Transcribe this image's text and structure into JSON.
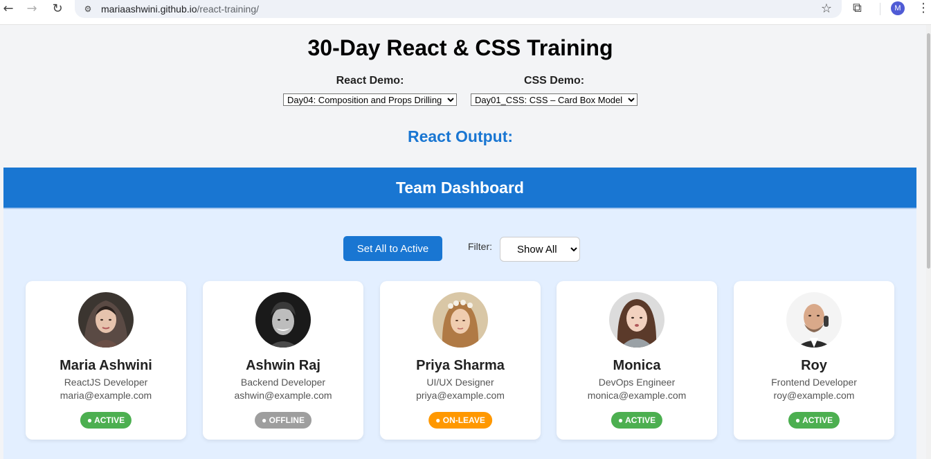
{
  "browser": {
    "url_domain": "mariaashwini.github.io",
    "url_path": "/react-training/",
    "profile_initial": "M",
    "icons": [
      "back-icon",
      "forward-icon",
      "reload-icon",
      "site-info-icon",
      "star-icon",
      "extensions-icon",
      "menu-icon"
    ]
  },
  "page": {
    "title": "30-Day React & CSS Training",
    "react_demo_label": "React Demo:",
    "react_demo_selected": "Day04: Composition and Props Drilling",
    "css_demo_label": "CSS Demo:",
    "css_demo_selected": "Day01_CSS: CSS – Card Box Model",
    "output_heading": "React Output:"
  },
  "dashboard": {
    "title": "Team Dashboard",
    "set_all_button": "Set All to Active",
    "filter_label": "Filter:",
    "filter_selected": "Show All",
    "members": [
      {
        "name": "Maria Ashwini",
        "role": "ReactJS Developer",
        "email": "maria@example.com",
        "status": "● ACTIVE"
      },
      {
        "name": "Ashwin Raj",
        "role": "Backend Developer",
        "email": "ashwin@example.com",
        "status": "● OFFLINE"
      },
      {
        "name": "Priya Sharma",
        "role": "UI/UX Designer",
        "email": "priya@example.com",
        "status": "● ON-LEAVE"
      },
      {
        "name": "Monica",
        "role": "DevOps Engineer",
        "email": "monica@example.com",
        "status": "● ACTIVE"
      },
      {
        "name": "Roy",
        "role": "Frontend Developer",
        "email": "roy@example.com",
        "status": "● ACTIVE"
      }
    ]
  },
  "colors": {
    "primary": "#1976d2",
    "dashboard_bg": "#e3efff",
    "status_active": "#4caf50",
    "status_offline": "#9e9e9e",
    "status_on_leave": "#ff9800"
  }
}
